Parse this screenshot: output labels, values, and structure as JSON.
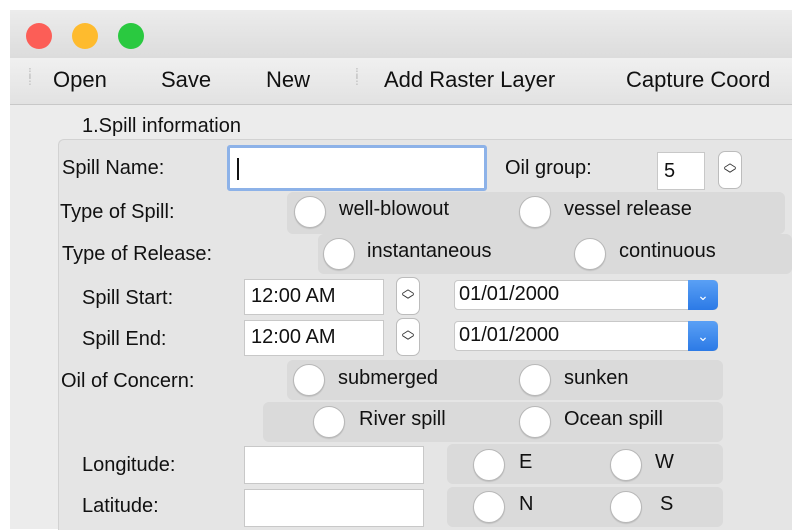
{
  "window": {
    "traffic_lights": {
      "close_color": "#fc5e57",
      "minimize_color": "#febb2e",
      "zoom_color": "#2ac940"
    }
  },
  "toolbar": {
    "open_label": "Open",
    "save_label": "Save",
    "new_label": "New",
    "add_raster_label": "Add Raster Layer",
    "capture_coord_label": "Capture Coord"
  },
  "section": {
    "title": "1.Spill information"
  },
  "spill_name": {
    "label": "Spill Name:",
    "value": ""
  },
  "oil_group": {
    "label": "Oil group:",
    "value": "5"
  },
  "type_of_spill": {
    "label": "Type of Spill:",
    "options": [
      "well-blowout",
      "vessel release"
    ]
  },
  "type_of_release": {
    "label": "Type of Release:",
    "options": [
      "instantaneous",
      "continuous"
    ]
  },
  "spill_start": {
    "label": "Spill Start:",
    "time": "12:00 AM",
    "date": "01/01/2000"
  },
  "spill_end": {
    "label": "Spill End:",
    "time": "12:00 AM",
    "date": "01/01/2000"
  },
  "oil_of_concern": {
    "label": "Oil of Concern:",
    "options": [
      "submerged",
      "sunken"
    ]
  },
  "spill_location": {
    "options": [
      "River spill",
      "Ocean spill"
    ]
  },
  "longitude": {
    "label": "Longitude:",
    "value": "",
    "directions": [
      "E",
      "W"
    ]
  },
  "latitude": {
    "label": "Latitude:",
    "value": "",
    "directions": [
      "N",
      "S"
    ]
  }
}
